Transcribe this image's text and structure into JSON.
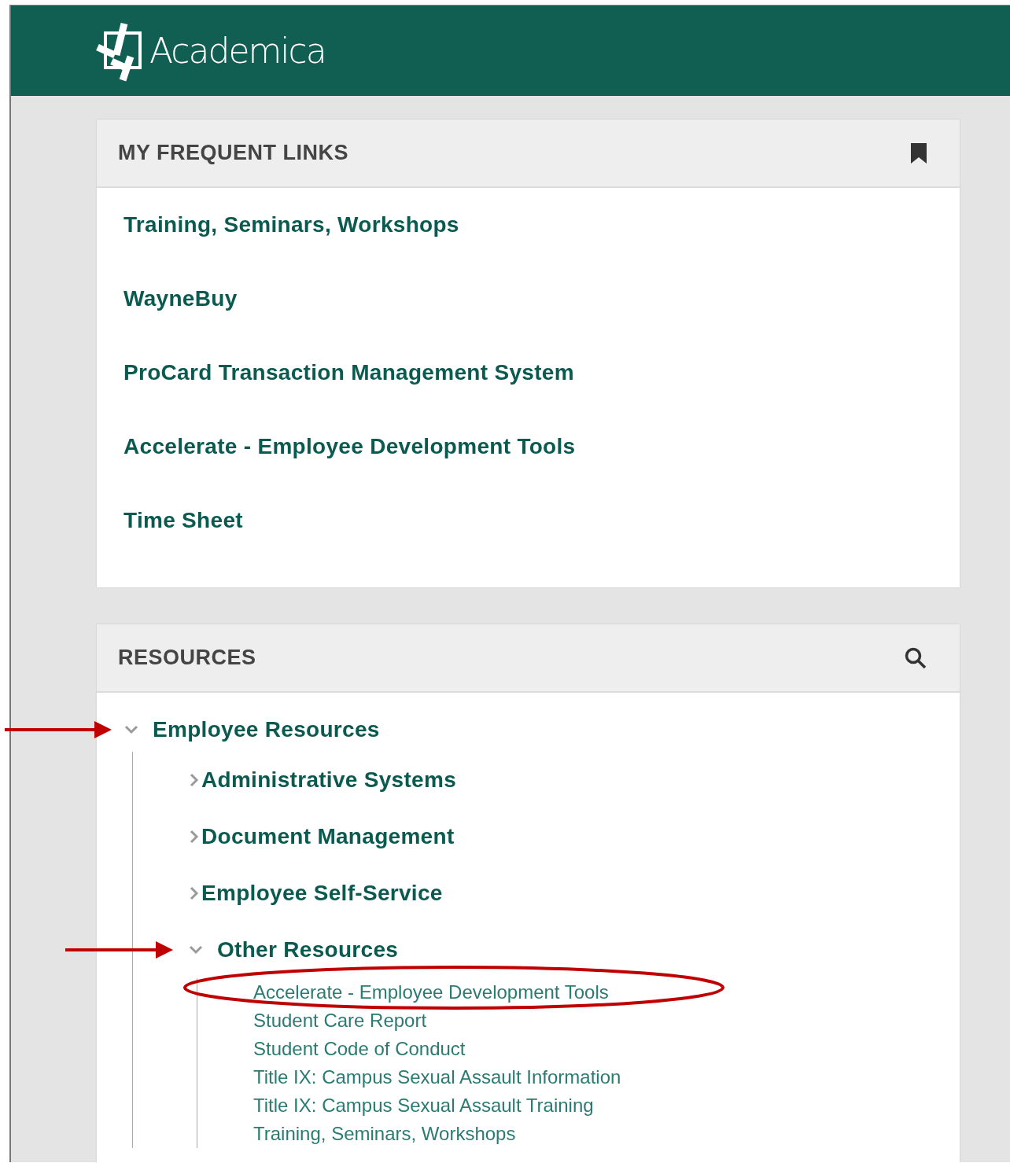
{
  "header": {
    "logo_text": "Academica"
  },
  "frequent_links": {
    "title": "MY FREQUENT LINKS",
    "links": [
      {
        "label": "Training, Seminars, Workshops"
      },
      {
        "label": "WayneBuy"
      },
      {
        "label": "ProCard Transaction Management System"
      },
      {
        "label": "Accelerate - Employee Development Tools"
      },
      {
        "label": "Time Sheet"
      }
    ]
  },
  "resources": {
    "title": "RESOURCES",
    "tree": [
      {
        "label": "Employee Resources",
        "expanded": true,
        "arrow": true,
        "children": [
          {
            "label": "Administrative Systems",
            "expanded": false,
            "arrow": false
          },
          {
            "label": "Document Management",
            "expanded": false,
            "arrow": false
          },
          {
            "label": "Employee Self-Service",
            "expanded": false,
            "arrow": false
          },
          {
            "label": "Other Resources",
            "expanded": true,
            "arrow": true,
            "children": [
              {
                "label": "Accelerate - Employee Development Tools",
                "circled": true
              },
              {
                "label": "Student Care Report",
                "circled": false
              },
              {
                "label": "Student Code of Conduct",
                "circled": false
              },
              {
                "label": "Title IX: Campus Sexual Assault Information",
                "circled": false
              },
              {
                "label": "Title IX: Campus Sexual Assault Training",
                "circled": false
              },
              {
                "label": "Training, Seminars, Workshops",
                "circled": false
              }
            ]
          }
        ]
      }
    ]
  }
}
